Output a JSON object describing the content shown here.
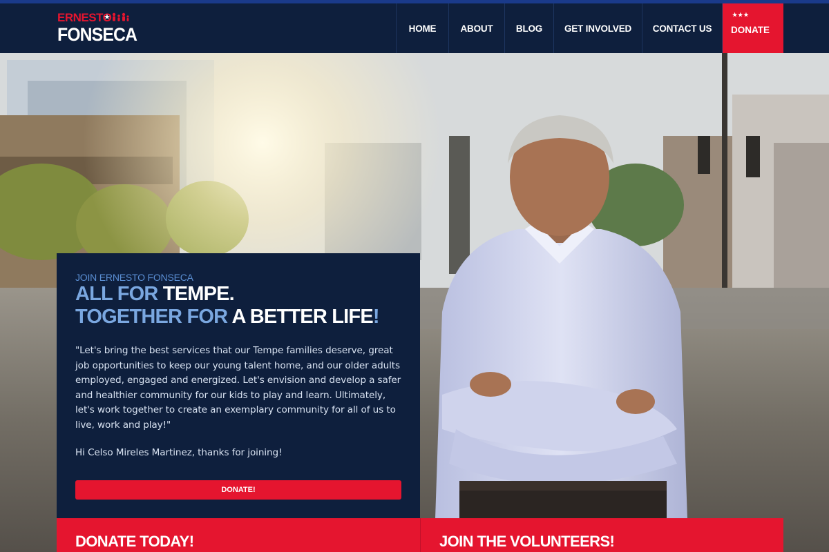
{
  "colors": {
    "navy": "#0e1f3d",
    "red": "#e5152f",
    "light_blue": "#7aa7e0",
    "kicker_blue": "#5b8fd4",
    "white": "#ffffff"
  },
  "logo": {
    "line1": "ERNESTO",
    "line2": "FONSECA",
    "star": "★",
    "icon": "family-people-icon"
  },
  "nav": {
    "home": "HOME",
    "about": "ABOUT",
    "blog": "BLOG",
    "get_involved": "GET INVOLVED",
    "contact": "CONTACT US",
    "donate": "DONATE",
    "donate_stars": "★★★"
  },
  "hero": {
    "kicker": "JOIN ERNESTO FONSECA",
    "headline_line1_a": "ALL FOR ",
    "headline_line1_b": "TEMPE.",
    "headline_line2_a": "TOGETHER FOR ",
    "headline_line2_b": "A BETTER LIFE",
    "headline_line2_c": "!",
    "quote": "\"Let's bring the best services that our Tempe families deserve, great job opportunities to keep our young talent home, and our older adults employed, engaged and energized. Let's envision and develop a safer and healthier community for our kids to play and learn. Ultimately, let's work together to create an exemplary community for all of us to live, work and play!\"",
    "thanks": "Hi Celso Mireles Martinez, thanks for joining!",
    "donate_button": "DONATE!"
  },
  "bands": {
    "left_title": "DONATE TODAY!",
    "right_title": "JOIN THE VOLUNTEERS!"
  }
}
